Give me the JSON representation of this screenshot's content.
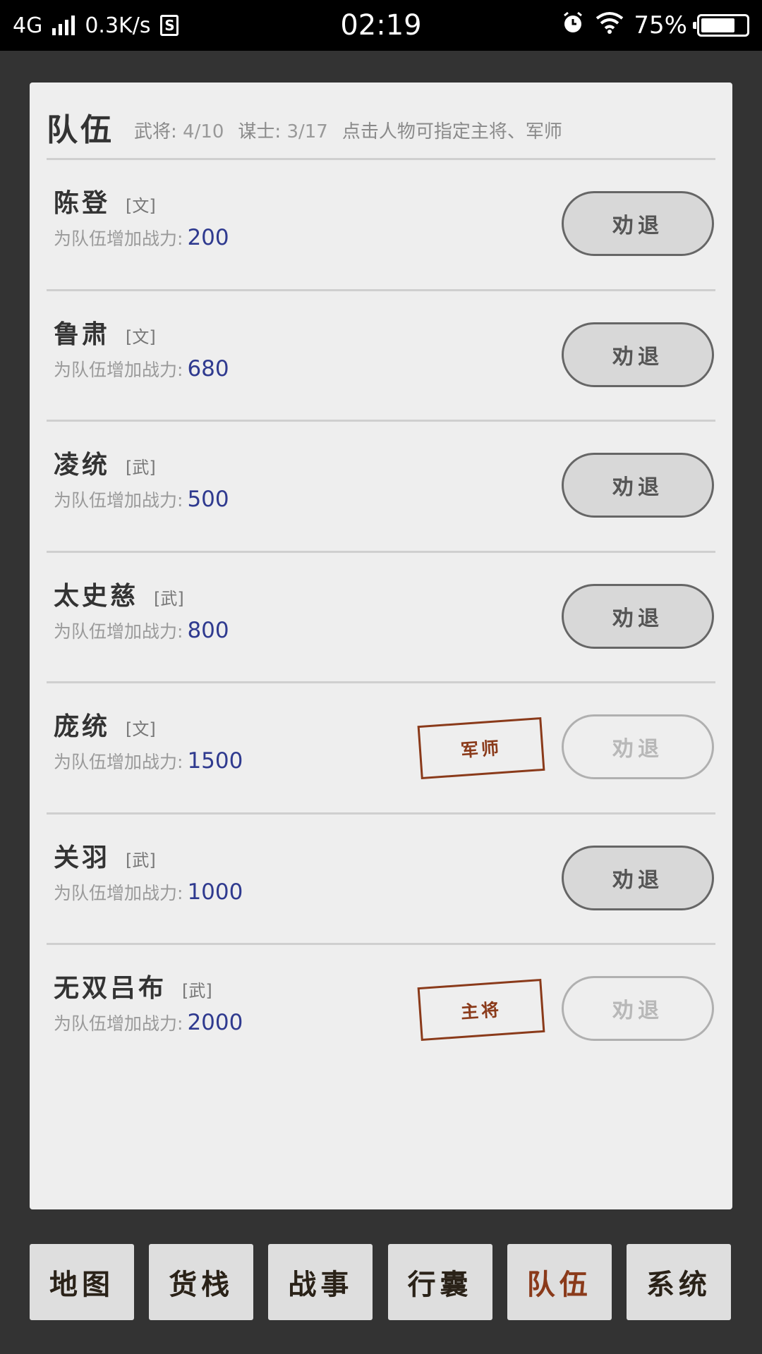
{
  "status_bar": {
    "network": "4G",
    "speed": "0.3K/s",
    "sim_label": "S",
    "time": "02:19",
    "battery": "75%",
    "battery_level": 0.75
  },
  "panel": {
    "title": "队伍",
    "generals_label": "武将:",
    "generals_count": "4/10",
    "advisors_label": "谋士:",
    "advisors_count": "3/17",
    "hint": "点击人物可指定主将、军师"
  },
  "members": [
    {
      "name": "陈登",
      "type": "[文]",
      "power_label": "为队伍增加战力:",
      "power": "200",
      "role": "",
      "dismiss_label": "劝退",
      "dismiss_enabled": true
    },
    {
      "name": "鲁肃",
      "type": "[文]",
      "power_label": "为队伍增加战力:",
      "power": "680",
      "role": "",
      "dismiss_label": "劝退",
      "dismiss_enabled": true
    },
    {
      "name": "凌统",
      "type": "[武]",
      "power_label": "为队伍增加战力:",
      "power": "500",
      "role": "",
      "dismiss_label": "劝退",
      "dismiss_enabled": true
    },
    {
      "name": "太史慈",
      "type": "[武]",
      "power_label": "为队伍增加战力:",
      "power": "800",
      "role": "",
      "dismiss_label": "劝退",
      "dismiss_enabled": true
    },
    {
      "name": "庞统",
      "type": "[文]",
      "power_label": "为队伍增加战力:",
      "power": "1500",
      "role": "军师",
      "dismiss_label": "劝退",
      "dismiss_enabled": false
    },
    {
      "name": "关羽",
      "type": "[武]",
      "power_label": "为队伍增加战力:",
      "power": "1000",
      "role": "",
      "dismiss_label": "劝退",
      "dismiss_enabled": true
    },
    {
      "name": "无双吕布",
      "type": "[武]",
      "power_label": "为队伍增加战力:",
      "power": "2000",
      "role": "主将",
      "dismiss_label": "劝退",
      "dismiss_enabled": false
    }
  ],
  "nav": [
    {
      "label": "地图",
      "active": false
    },
    {
      "label": "货栈",
      "active": false
    },
    {
      "label": "战事",
      "active": false
    },
    {
      "label": "行囊",
      "active": false
    },
    {
      "label": "队伍",
      "active": true
    },
    {
      "label": "系统",
      "active": false
    }
  ],
  "colors": {
    "power_value": "#2f3a8f",
    "stamp": "#8a3a1a",
    "active_nav": "#8a3a1a"
  }
}
